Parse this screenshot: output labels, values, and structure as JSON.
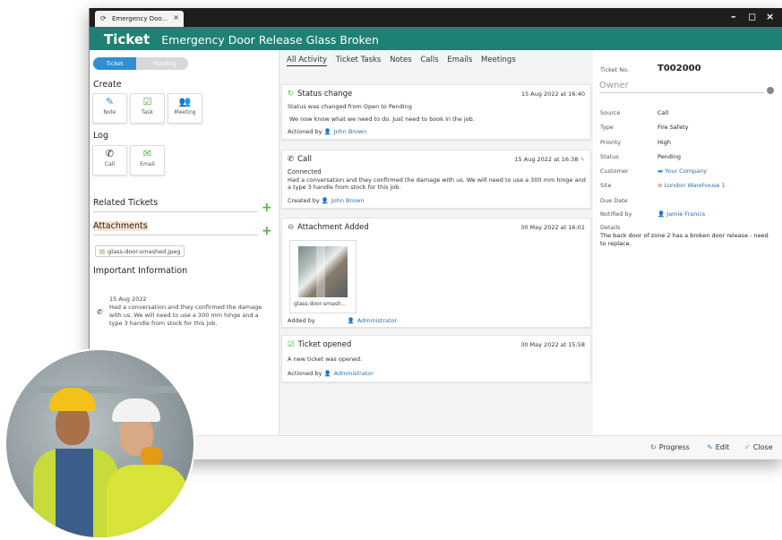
{
  "browser": {
    "tab_title": "Emergency Doo...",
    "tab_close": "×",
    "controls": {
      "minimize": "–",
      "maximize": "◻",
      "close": "×"
    }
  },
  "header": {
    "type": "Ticket",
    "title": "Emergency Door Release Glass Broken"
  },
  "status_steps": [
    "Ticket",
    "Pending"
  ],
  "left": {
    "create_title": "Create",
    "create_tiles": [
      {
        "label": "Note",
        "icon": "note-icon"
      },
      {
        "label": "Task",
        "icon": "task-icon"
      },
      {
        "label": "Meeting",
        "icon": "meeting-icon"
      }
    ],
    "log_title": "Log",
    "log_tiles": [
      {
        "label": "Call",
        "icon": "phone-icon"
      },
      {
        "label": "Email",
        "icon": "email-icon"
      }
    ],
    "related_title": "Related Tickets",
    "attachments_title": "Attachments",
    "attachment_file": "glass-door-smashed.jpeg",
    "important_title": "Important Information",
    "important_date": "15 Aug 2022",
    "important_text": "Had a conversation and they confirmed the damage with us. We will need to use a 300 mm hinge and a type 3 handle from stock for this job."
  },
  "activity": {
    "tabs": [
      "All Activity",
      "Ticket Tasks",
      "Notes",
      "Calls",
      "Emails",
      "Meetings"
    ],
    "cards": [
      {
        "title": "Status change",
        "date": "15 Aug 2022 at 16:40",
        "lines": [
          "Status was changed from Open to Pending",
          "We now know what we need to do. Just need to book in the job."
        ],
        "by_label": "Actioned by",
        "by_user": "John Brown"
      },
      {
        "title": "Call",
        "date": "15 Aug 2022 at 16:38",
        "lines": [
          "Connected",
          "Had a conversation and they confirmed the damage with us. We will need to use a 300 mm hinge and a type 3 handle from stock for this job."
        ],
        "by_label": "Created by",
        "by_user": "John Brown"
      },
      {
        "title": "Attachment Added",
        "date": "30 May 2022 at 16:01",
        "thumb_caption": "glass-door-smash...",
        "by_label": "Added by",
        "by_user": "Administrator"
      },
      {
        "title": "Ticket opened",
        "date": "30 May 2022 at 15:58",
        "lines": [
          "A new ticket was opened."
        ],
        "by_label": "Actioned by",
        "by_user": "Administrator"
      }
    ]
  },
  "details": {
    "ticket_no_label": "Ticket No.",
    "ticket_no": "T002000",
    "owner_label": "Owner",
    "rows": [
      {
        "label": "Source",
        "value": "Call"
      },
      {
        "label": "Type",
        "value": "Fire Safety"
      },
      {
        "label": "Priority",
        "value": "High"
      },
      {
        "label": "Status",
        "value": "Pending"
      },
      {
        "label": "Customer",
        "value": "Your Company"
      },
      {
        "label": "Site",
        "value": "London Warehouse 1"
      },
      {
        "label": "Due Date",
        "value": ""
      },
      {
        "label": "Notified by",
        "value": "Jamie Francis"
      }
    ],
    "details_label": "Details",
    "details_text": "The back door of zone 2 has a broken door release - need to replace."
  },
  "footer": {
    "progress": "Progress",
    "edit": "Edit",
    "close": "Close"
  },
  "colors": {
    "header": "#1f8173",
    "step_active": "#2f8fd0",
    "plus": "#52b447",
    "link": "#2a6fb0"
  }
}
